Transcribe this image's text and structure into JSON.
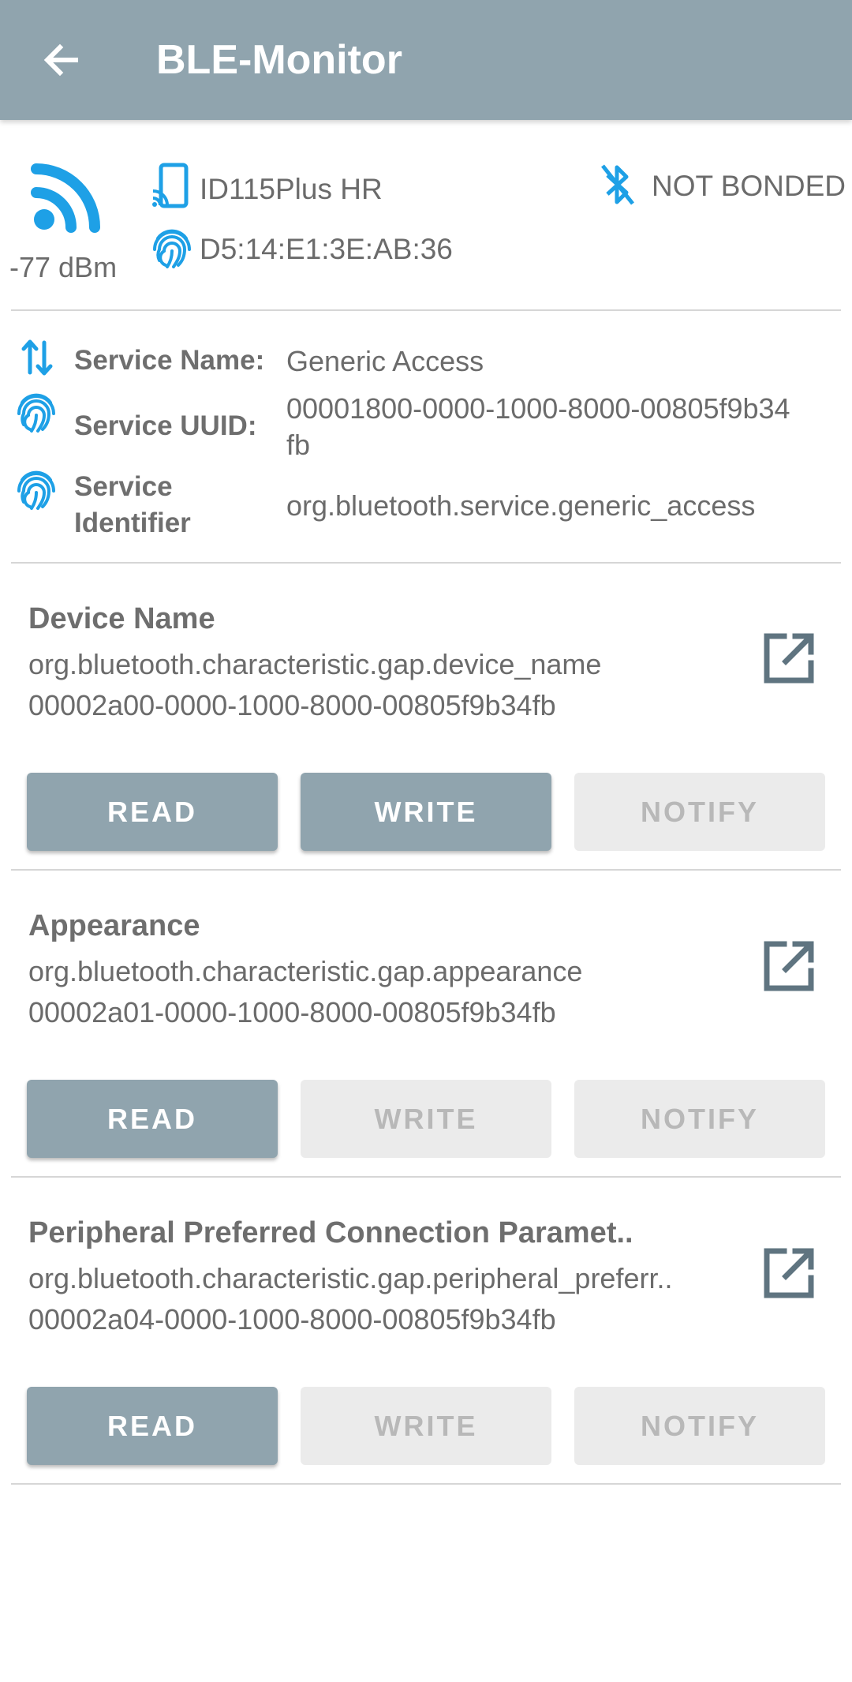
{
  "appbar": {
    "title": "BLE-Monitor",
    "back_icon": "arrow-left-icon"
  },
  "device": {
    "rssi": "-77 dBm",
    "name": "ID115Plus HR",
    "mac": "D5:14:E1:3E:AB:36",
    "bond_status": "NOT BONDED"
  },
  "service": {
    "name_label": "Service Name:",
    "name_value": "Generic Access",
    "uuid_label": "Service UUID:",
    "uuid_value_line1": "00001800-0000-1000-8000-00805f9b34",
    "uuid_value_line2": "fb",
    "identifier_label_line1": "Service",
    "identifier_label_line2": "Identifier",
    "identifier_value": "org.bluetooth.service.generic_access"
  },
  "characteristics": [
    {
      "name": "Device Name",
      "identifier": "org.bluetooth.characteristic.gap.device_name",
      "uuid": "00002a00-0000-1000-8000-00805f9b34fb",
      "read": "READ",
      "write": "WRITE",
      "notify": "NOTIFY"
    },
    {
      "name": "Appearance",
      "identifier": "org.bluetooth.characteristic.gap.appearance",
      "uuid": "00002a01-0000-1000-8000-00805f9b34fb",
      "read": "READ",
      "write": "WRITE",
      "notify": "NOTIFY"
    },
    {
      "name": "Peripheral Preferred Connection Paramet..",
      "identifier": "org.bluetooth.characteristic.gap.peripheral_preferr..",
      "uuid": "00002a04-0000-1000-8000-00805f9b34fb",
      "read": "READ",
      "write": "WRITE",
      "notify": "NOTIFY"
    }
  ],
  "colors": {
    "appbar": "#90a4ae",
    "accent_blue": "#1ea0e6",
    "button_enabled": "#90a4ae",
    "button_disabled": "#ebebeb"
  }
}
